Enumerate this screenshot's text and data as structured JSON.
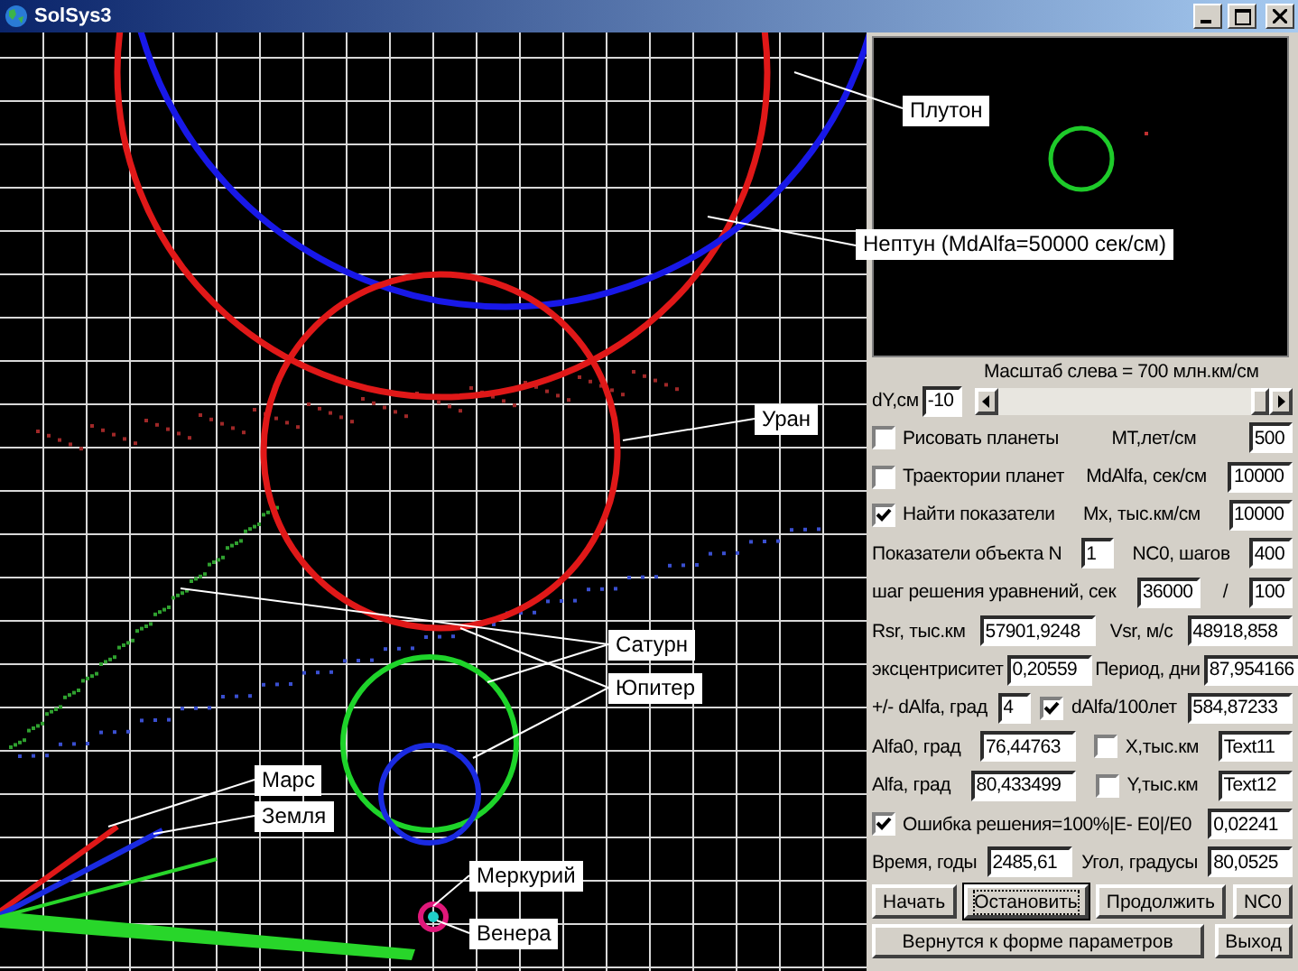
{
  "window": {
    "title": "SolSys3"
  },
  "plot": {
    "labels": [
      {
        "text": "Плутон"
      },
      {
        "text": "Нептун (MdAlfa=50000 сек/см)"
      },
      {
        "text": "Уран"
      },
      {
        "text": "Сатурн"
      },
      {
        "text": "Юпитер"
      },
      {
        "text": "Марс"
      },
      {
        "text": "Земля"
      },
      {
        "text": "Меркурий"
      },
      {
        "text": "Венера"
      }
    ]
  },
  "panel": {
    "scale_caption": "Масштаб слева = 700 млн.км/см",
    "offset": {
      "label": "dY,см",
      "value": "-10"
    },
    "rows": [
      [
        {
          "kind": "check",
          "label": "Рисовать планеты",
          "checked": false
        },
        {
          "kind": "label",
          "text": "MT,лет/см"
        },
        {
          "kind": "field",
          "value": "500"
        }
      ],
      [
        {
          "kind": "check",
          "label": "Траектории планет",
          "checked": false
        },
        {
          "kind": "label",
          "text": "MdAlfa, сек/см"
        },
        {
          "kind": "field",
          "value": "10000"
        }
      ],
      [
        {
          "kind": "check",
          "label": "Найти показатели",
          "checked": true
        },
        {
          "kind": "label",
          "text": "Mx, тыс.км/см"
        },
        {
          "kind": "field",
          "value": "10000"
        }
      ],
      [
        {
          "kind": "label",
          "text": "Показатели объекта N"
        },
        {
          "kind": "field",
          "value": "1"
        },
        {
          "kind": "label",
          "text": "NC0, шагов"
        },
        {
          "kind": "field",
          "value": "400"
        }
      ],
      [
        {
          "kind": "label",
          "text": "шаг решения уравнений, сек"
        },
        {
          "kind": "field",
          "value": "36000"
        },
        {
          "kind": "label",
          "text": "/"
        },
        {
          "kind": "field",
          "value": "100"
        }
      ],
      [
        {
          "kind": "label",
          "text": "Rsr, тыс.км"
        },
        {
          "kind": "field",
          "value": "57901,9248"
        },
        {
          "kind": "label",
          "text": "Vsr, м/с"
        },
        {
          "kind": "field",
          "value": "48918,858"
        }
      ],
      [
        {
          "kind": "label",
          "text": "эксцентриситет"
        },
        {
          "kind": "field",
          "value": "0,20559"
        },
        {
          "kind": "label",
          "text": "Период, дни"
        },
        {
          "kind": "field",
          "value": "87,954166"
        }
      ],
      [
        {
          "kind": "label",
          "text": "+/- dAlfa, град"
        },
        {
          "kind": "field",
          "value": "4"
        },
        {
          "kind": "check",
          "label": "dAlfa/100лет",
          "checked": true
        },
        {
          "kind": "field",
          "value": "584,87233"
        }
      ],
      [
        {
          "kind": "label",
          "text": "Alfa0, град"
        },
        {
          "kind": "field",
          "value": "76,44763"
        },
        {
          "kind": "check",
          "label": "X,тыс.км",
          "checked": false
        },
        {
          "kind": "field",
          "value": "Text11"
        }
      ],
      [
        {
          "kind": "label",
          "text": "Alfa, град"
        },
        {
          "kind": "field",
          "value": "80,433499"
        },
        {
          "kind": "check",
          "label": "Y,тыс.км",
          "checked": false
        },
        {
          "kind": "field",
          "value": "Text12"
        }
      ],
      [
        {
          "kind": "check",
          "label": "Ошибка решения=100%|E- E0|/E0",
          "checked": true
        },
        {
          "kind": "field",
          "value": "0,02241"
        }
      ],
      [
        {
          "kind": "label",
          "text": "Время, годы"
        },
        {
          "kind": "field",
          "value": "2485,61"
        },
        {
          "kind": "label",
          "text": "Угол, градусы"
        },
        {
          "kind": "field",
          "value": "80,0525"
        }
      ],
      [
        {
          "kind": "button",
          "label": "Начать",
          "focused": false
        },
        {
          "kind": "button",
          "label": "Остановить",
          "focused": true
        },
        {
          "kind": "button",
          "label": "Продолжить",
          "focused": false
        },
        {
          "kind": "button",
          "label": "NC0",
          "focused": false
        }
      ],
      [
        {
          "kind": "button",
          "label": "Вернутся к форме параметров",
          "focused": false
        },
        {
          "kind": "button",
          "label": "Выход",
          "focused": false
        }
      ]
    ]
  }
}
